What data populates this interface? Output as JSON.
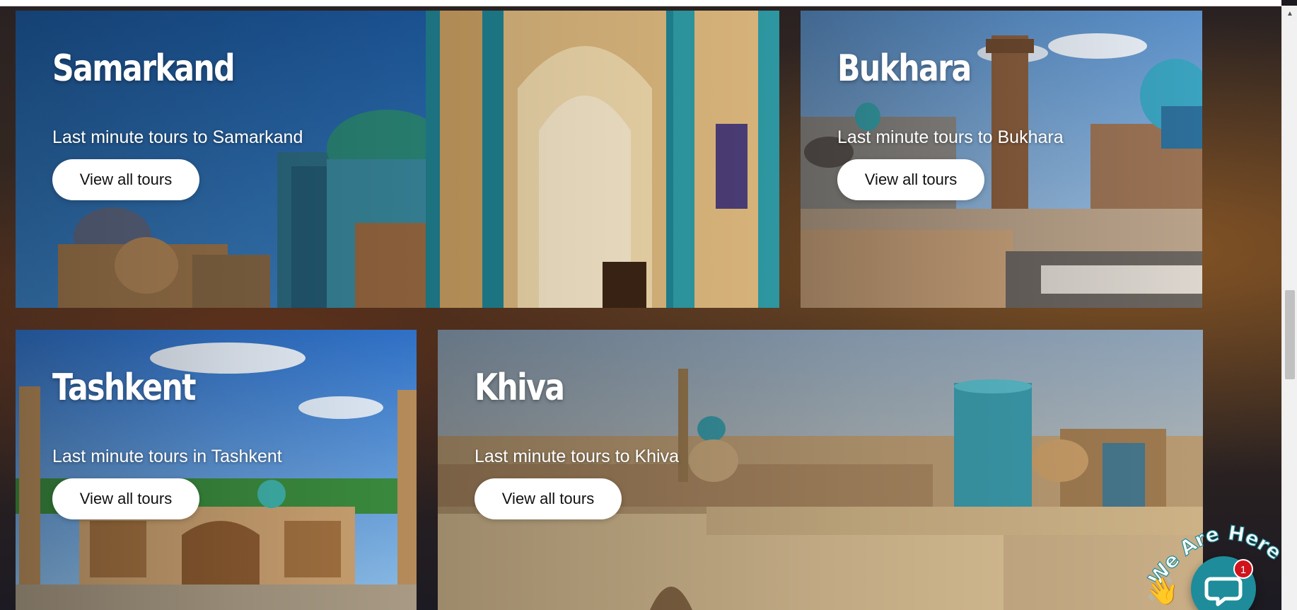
{
  "cards": [
    {
      "name": "Samarkand",
      "subtitle": "Last minute tours to Samarkand",
      "button_label": "View all tours"
    },
    {
      "name": "Bukhara",
      "subtitle": "Last minute tours to Bukhara",
      "button_label": "View all tours"
    },
    {
      "name": "Tashkent",
      "subtitle": "Last minute tours in Tashkent",
      "button_label": "View all tours"
    },
    {
      "name": "Khiva",
      "subtitle": "Last minute tours to Khiva",
      "button_label": "View all tours"
    }
  ],
  "chat": {
    "tagline": "We Are Here!",
    "unread_count": "1",
    "hand_icon": "waving-hand-icon",
    "bubble_icon": "chat-bubble-icon",
    "accent_color": "#1e8c9a",
    "badge_color": "#d0141b"
  },
  "scrollbar": {
    "up_arrow_icon": "scroll-up-arrow-icon"
  }
}
